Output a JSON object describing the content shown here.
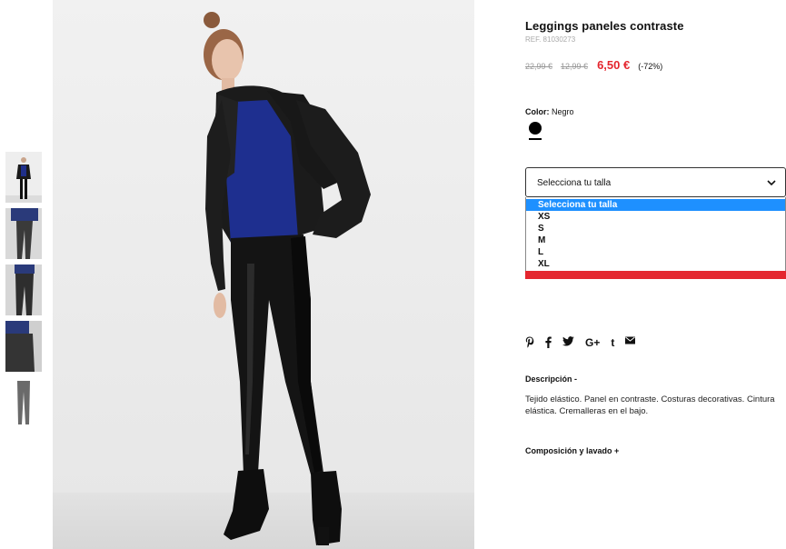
{
  "product": {
    "title": "Leggings paneles contraste",
    "ref": "REF. 81030273",
    "prices": {
      "original": "22,99 €",
      "previous": "12,99 €",
      "sale": "6,50 €",
      "discount": "(-72%)"
    },
    "color": {
      "label": "Color:",
      "value": "Negro",
      "swatch_color": "#000000"
    },
    "size": {
      "placeholder": "Selecciona tu talla",
      "options": [
        "Selecciona tu talla",
        "XS",
        "S",
        "M",
        "L",
        "XL"
      ],
      "highlighted_option": "Selecciona tu talla"
    },
    "share_icons": [
      "pinterest-icon",
      "facebook-icon",
      "twitter-icon",
      "google-plus-icon",
      "tumblr-icon",
      "email-icon"
    ],
    "description": {
      "heading": "Descripción -",
      "text": "Tejido elástico. Panel en contraste. Costuras decorativas. Cintura elástica. Cremalleras en el bajo."
    },
    "composition": {
      "heading": "Composición y lavado +"
    }
  },
  "gallery": {
    "thumbnail_count": 5,
    "active_thumbnail": 1
  },
  "colors": {
    "accent_red": "#e4262e",
    "select_highlight": "#1e90ff",
    "text": "#111111"
  }
}
